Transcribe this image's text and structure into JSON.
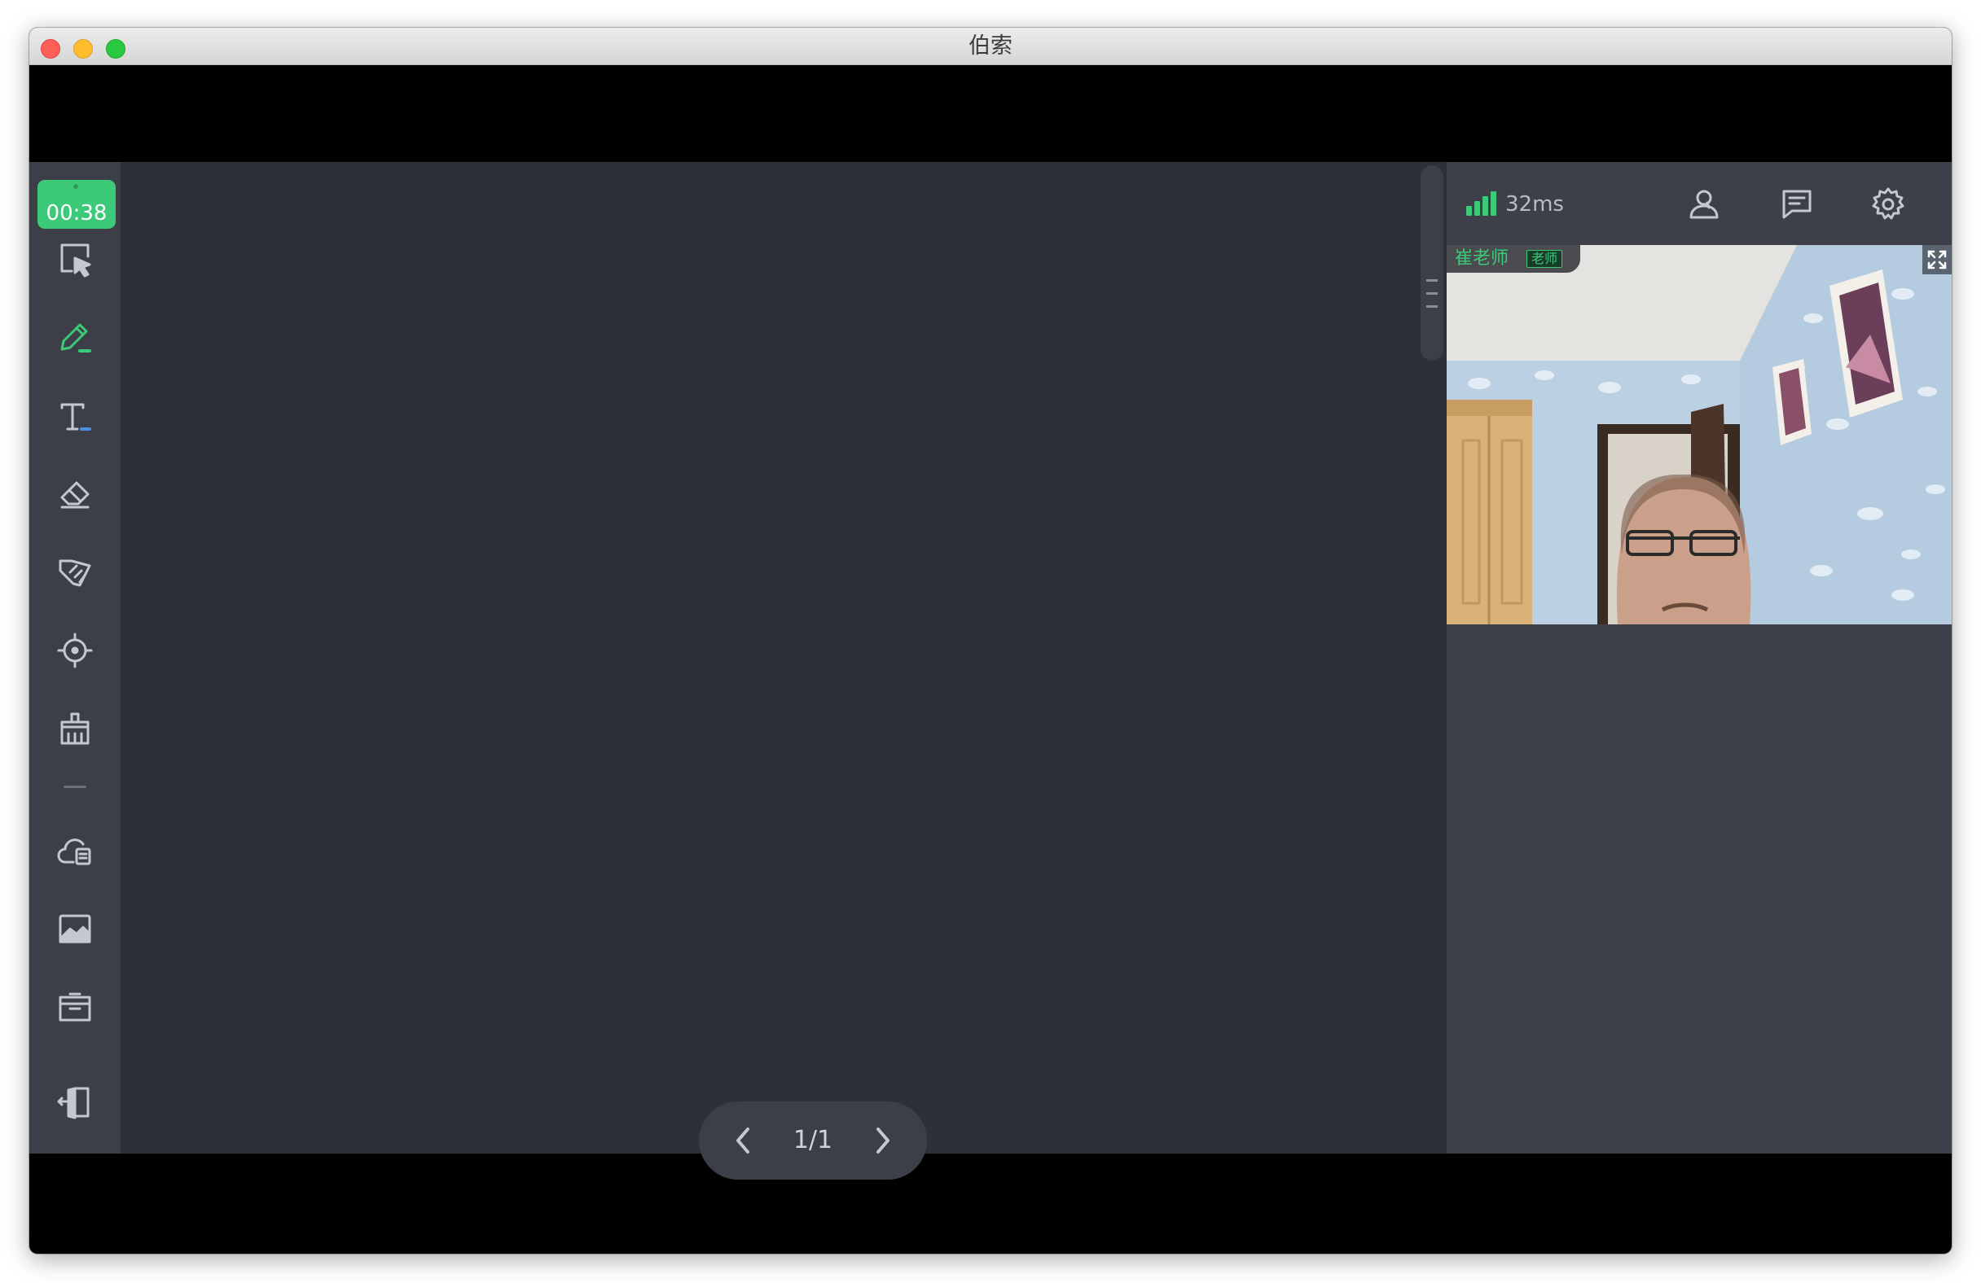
{
  "window": {
    "title": "伯索"
  },
  "toolbar": {
    "timer": "00:38",
    "tools": [
      {
        "name": "select-tool",
        "icon": "select-pointer-icon",
        "active": false
      },
      {
        "name": "pen-tool",
        "icon": "pen-icon",
        "active": true
      },
      {
        "name": "text-tool",
        "icon": "text-icon",
        "active": false
      },
      {
        "name": "eraser-tool",
        "icon": "eraser-icon",
        "active": false
      },
      {
        "name": "ruler-tool",
        "icon": "ruler-icon",
        "active": false
      },
      {
        "name": "laser-pointer-tool",
        "icon": "crosshair-icon",
        "active": false
      },
      {
        "name": "clear-tool",
        "icon": "broom-icon",
        "active": false
      },
      {
        "name": "cloud-files-tool",
        "icon": "cloud-file-icon",
        "active": false
      },
      {
        "name": "image-tool",
        "icon": "image-icon",
        "active": false
      },
      {
        "name": "toolbox-tool",
        "icon": "box-icon",
        "active": false
      },
      {
        "name": "exit-tool",
        "icon": "exit-door-icon",
        "active": false
      }
    ]
  },
  "pager": {
    "label": "1/1"
  },
  "panel": {
    "latency": "32ms",
    "signal_bars": 4,
    "header_icons": [
      "user-icon",
      "chat-icon",
      "gear-icon"
    ],
    "video": {
      "name": "崔老师",
      "role": "老师"
    }
  },
  "colors": {
    "accent": "#3dca78",
    "canvas_bg": "#2d3038",
    "toolbar_bg": "#3c3f48",
    "panel_bg": "#3d4049",
    "icon": "#c5c8ce"
  }
}
